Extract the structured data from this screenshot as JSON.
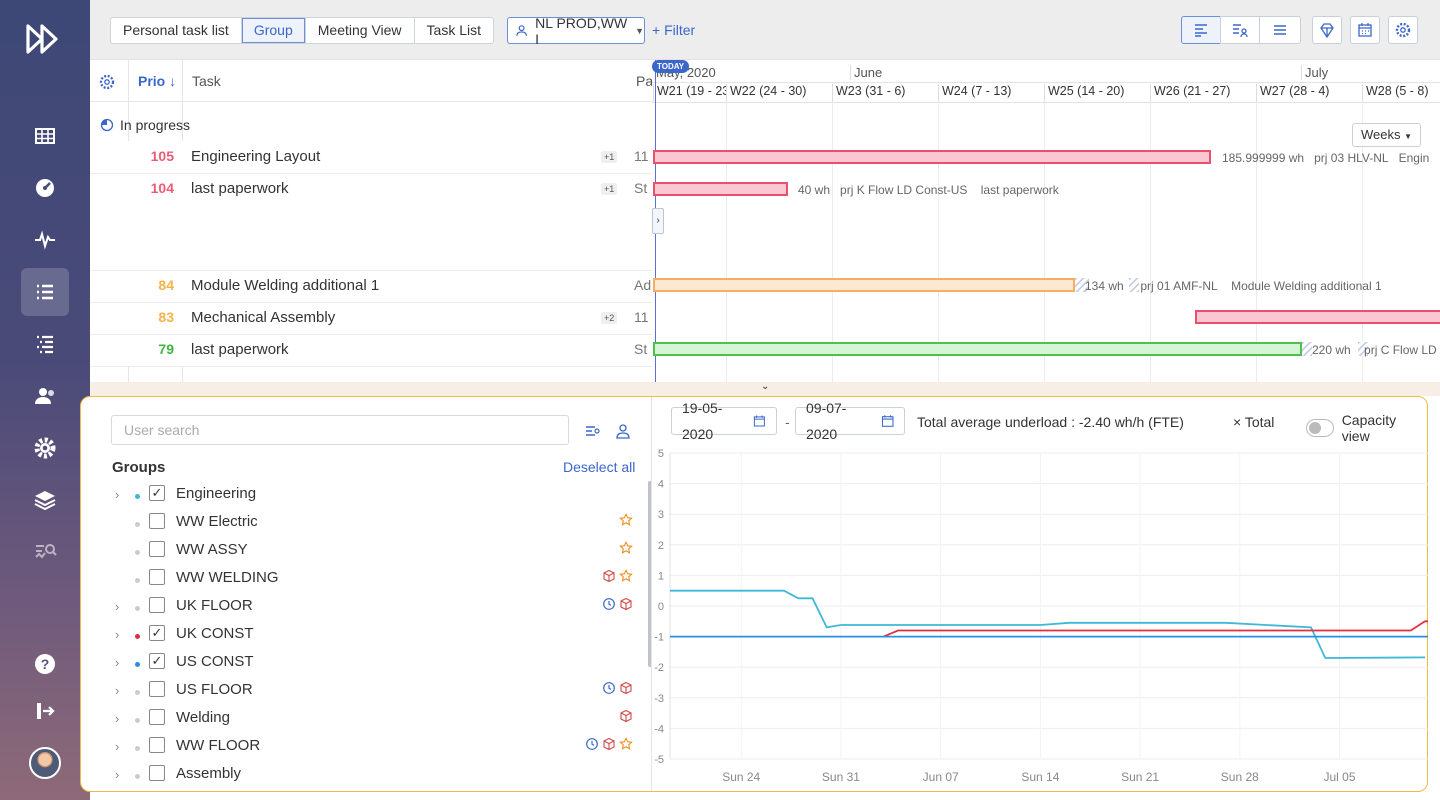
{
  "tabs": [
    "Personal task list",
    "Group",
    "Meeting View",
    "Task List"
  ],
  "selected_tab": "Group",
  "group_selector": "NL PROD,WW I",
  "filter_label": "+ Filter",
  "columns": {
    "prio": "Prio ↓",
    "task": "Task",
    "pa": "Pa"
  },
  "status_group": "In progress",
  "tasks": [
    {
      "prio": "105",
      "color": "#f05a78",
      "name": "Engineering Layout",
      "plus": "+1",
      "pa": "11"
    },
    {
      "prio": "104",
      "color": "#f05a78",
      "name": "last paperwork",
      "plus": "+1",
      "pa": "St"
    },
    {
      "prio": "84",
      "color": "#f7b24a",
      "name": "Module Welding additional 1",
      "plus": "",
      "pa": "Ad"
    },
    {
      "prio": "83",
      "color": "#f7b24a",
      "name": "Mechanical Assembly",
      "plus": "+2",
      "pa": "11"
    },
    {
      "prio": "79",
      "color": "#3db83d",
      "name": "last paperwork",
      "plus": "",
      "pa": "St"
    }
  ],
  "gantt": {
    "months": [
      "May, 2020",
      "June",
      "July"
    ],
    "weeks": [
      "W21 (19 - 23)",
      "W22 (24 - 30)",
      "W23 (31 - 6)",
      "W24 (7 - 13)",
      "W25 (14 - 20)",
      "W26 (21 - 27)",
      "W27 (28 - 4)",
      "W28 (5 - 8)"
    ],
    "today": "TODAY",
    "scale": "Weeks",
    "bar_labels": [
      {
        "wh": "185.999999 wh",
        "prj": "prj 03 HLV-NL",
        "name": "Engin"
      },
      {
        "wh": "40 wh",
        "prj": "prj K Flow LD Const-US",
        "name": "last paperwork"
      },
      {
        "wh": "134 wh",
        "prj": "prj 01 AMF-NL",
        "name": "Module Welding additional 1"
      },
      {
        "wh": "220 wh",
        "prj": "prj C Flow LD",
        "name": ""
      }
    ]
  },
  "user_search_placeholder": "User search",
  "groups_title": "Groups",
  "deselect_all": "Deselect all",
  "groups": [
    {
      "name": "Engineering",
      "checked": true,
      "dot": "#3fb8d8",
      "expand": true,
      "icons": []
    },
    {
      "name": "WW Electric",
      "checked": false,
      "dot": "#cccccc",
      "expand": false,
      "icons": [
        "star"
      ]
    },
    {
      "name": "WW ASSY",
      "checked": false,
      "dot": "#cccccc",
      "expand": false,
      "icons": [
        "star"
      ]
    },
    {
      "name": "WW WELDING",
      "checked": false,
      "dot": "#cccccc",
      "expand": false,
      "icons": [
        "cube",
        "star"
      ]
    },
    {
      "name": "UK FLOOR",
      "checked": false,
      "dot": "#cccccc",
      "expand": true,
      "icons": [
        "clock",
        "cube"
      ]
    },
    {
      "name": "UK CONST",
      "checked": true,
      "dot": "#e03040",
      "expand": true,
      "icons": []
    },
    {
      "name": "US CONST",
      "checked": true,
      "dot": "#2b8fe0",
      "expand": true,
      "icons": []
    },
    {
      "name": "US FLOOR",
      "checked": false,
      "dot": "#cccccc",
      "expand": true,
      "icons": [
        "clock",
        "cube"
      ]
    },
    {
      "name": "Welding",
      "checked": false,
      "dot": "#cccccc",
      "expand": true,
      "icons": [
        "cube"
      ]
    },
    {
      "name": "WW FLOOR",
      "checked": false,
      "dot": "#cccccc",
      "expand": true,
      "icons": [
        "clock",
        "cube",
        "star"
      ]
    },
    {
      "name": "Assembly",
      "checked": false,
      "dot": "#cccccc",
      "expand": true,
      "icons": []
    }
  ],
  "date_from": "19-05-2020",
  "date_to": "09-07-2020",
  "underload_text": "Total average underload : -2.40 wh/h (FTE)",
  "total_label": "× Total",
  "capacity_view_label": "Capacity view",
  "chart_data": {
    "type": "line",
    "x_ticks": [
      "Sun 24",
      "Sun 31",
      "Jun 07",
      "Sun 14",
      "Sun 21",
      "Sun 28",
      "Jul 05"
    ],
    "ylim": [
      -5,
      5
    ],
    "y_ticks": [
      5,
      4,
      3,
      2,
      1,
      0,
      -1,
      -2,
      -3,
      -4,
      -5
    ],
    "x_range_days": [
      0,
      53
    ],
    "series": [
      {
        "color": "#3fb8d8",
        "points": [
          [
            0,
            0.5
          ],
          [
            8,
            0.5
          ],
          [
            9,
            0.25
          ],
          [
            10,
            0.25
          ],
          [
            11,
            -0.7
          ],
          [
            12,
            -0.62
          ],
          [
            20,
            -0.62
          ],
          [
            26,
            -0.62
          ],
          [
            28,
            -0.55
          ],
          [
            39,
            -0.55
          ],
          [
            45,
            -0.7
          ],
          [
            46,
            -1.7
          ],
          [
            53,
            -1.68
          ]
        ]
      },
      {
        "color": "#e03040",
        "points": [
          [
            15,
            -1.0
          ],
          [
            16,
            -0.8
          ],
          [
            33,
            -0.8
          ],
          [
            45,
            -0.8
          ],
          [
            46,
            -0.8
          ],
          [
            52,
            -0.8
          ],
          [
            53,
            -0.5
          ],
          [
            60,
            -0.5
          ]
        ]
      },
      {
        "color": "#2b8fe0",
        "points": [
          [
            0,
            -1.0
          ],
          [
            45,
            -1.0
          ],
          [
            58,
            -1.0
          ],
          [
            59,
            -0.28
          ],
          [
            62,
            -0.28
          ]
        ]
      }
    ]
  }
}
